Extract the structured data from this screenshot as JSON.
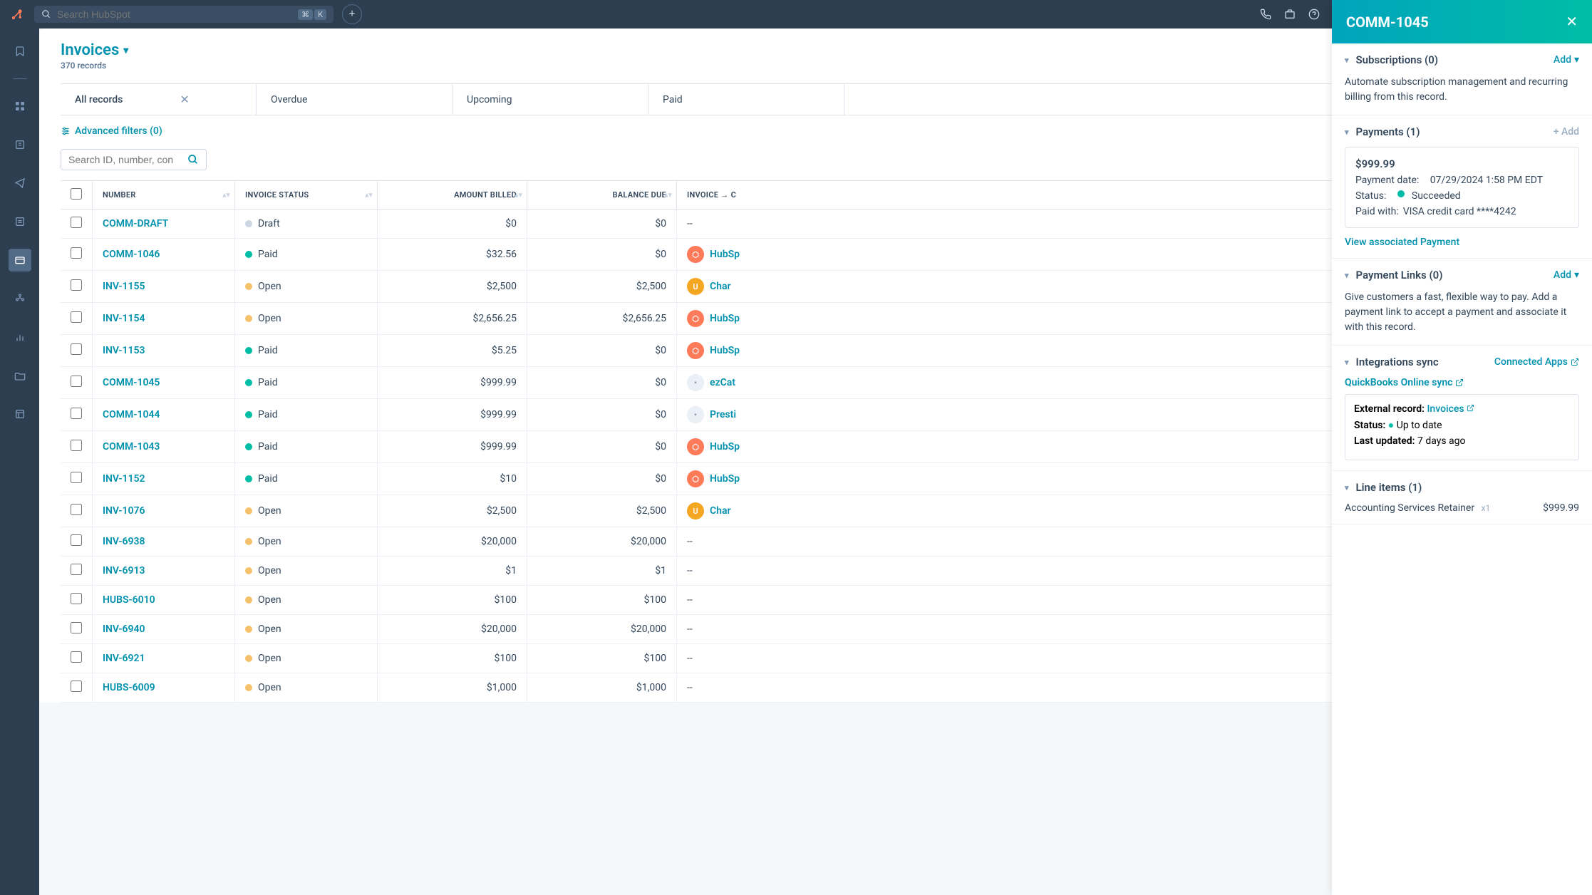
{
  "topbar": {
    "search_placeholder": "Search HubSpot",
    "kbd1": "⌘",
    "kbd2": "K"
  },
  "page": {
    "title": "Invoices",
    "record_count": "370 records"
  },
  "tabs": [
    {
      "label": "All records",
      "closable": true
    },
    {
      "label": "Overdue",
      "closable": false
    },
    {
      "label": "Upcoming",
      "closable": false
    },
    {
      "label": "Paid",
      "closable": false
    }
  ],
  "advanced_filters_label": "Advanced filters (0)",
  "search_table_placeholder": "Search ID, number, con",
  "columns": {
    "number": "Number",
    "status": "Invoice Status",
    "amount": "Amount Billed",
    "balance": "Balance Due",
    "contact": "Invoice → C"
  },
  "rows": [
    {
      "number": "COMM-DRAFT",
      "status": "Draft",
      "status_kind": "draft",
      "amount": "$0",
      "balance": "$0",
      "contact": "--",
      "avatar": ""
    },
    {
      "number": "COMM-1046",
      "status": "Paid",
      "status_kind": "paid",
      "amount": "$32.56",
      "balance": "$0",
      "contact": "HubSp",
      "avatar": "hub"
    },
    {
      "number": "INV-1155",
      "status": "Open",
      "status_kind": "open",
      "amount": "$2,500",
      "balance": "$2,500",
      "contact": "Char ",
      "avatar": "char"
    },
    {
      "number": "INV-1154",
      "status": "Open",
      "status_kind": "open",
      "amount": "$2,656.25",
      "balance": "$2,656.25",
      "contact": "HubSp",
      "avatar": "hub"
    },
    {
      "number": "INV-1153",
      "status": "Paid",
      "status_kind": "paid",
      "amount": "$5.25",
      "balance": "$0",
      "contact": "HubSp",
      "avatar": "hub"
    },
    {
      "number": "COMM-1045",
      "status": "Paid",
      "status_kind": "paid",
      "amount": "$999.99",
      "balance": "$0",
      "contact": "ezCat",
      "avatar": "ez"
    },
    {
      "number": "COMM-1044",
      "status": "Paid",
      "status_kind": "paid",
      "amount": "$999.99",
      "balance": "$0",
      "contact": "Presti",
      "avatar": "pres"
    },
    {
      "number": "COMM-1043",
      "status": "Paid",
      "status_kind": "paid",
      "amount": "$999.99",
      "balance": "$0",
      "contact": "HubSp",
      "avatar": "hub"
    },
    {
      "number": "INV-1152",
      "status": "Paid",
      "status_kind": "paid",
      "amount": "$10",
      "balance": "$0",
      "contact": "HubSp",
      "avatar": "hub"
    },
    {
      "number": "INV-1076",
      "status": "Open",
      "status_kind": "open",
      "amount": "$2,500",
      "balance": "$2,500",
      "contact": "Char ",
      "avatar": "char"
    },
    {
      "number": "INV-6938",
      "status": "Open",
      "status_kind": "open",
      "amount": "$20,000",
      "balance": "$20,000",
      "contact": "--",
      "avatar": ""
    },
    {
      "number": "INV-6913",
      "status": "Open",
      "status_kind": "open",
      "amount": "$1",
      "balance": "$1",
      "contact": "--",
      "avatar": ""
    },
    {
      "number": "HUBS-6010",
      "status": "Open",
      "status_kind": "open",
      "amount": "$100",
      "balance": "$100",
      "contact": "--",
      "avatar": ""
    },
    {
      "number": "INV-6940",
      "status": "Open",
      "status_kind": "open",
      "amount": "$20,000",
      "balance": "$20,000",
      "contact": "--",
      "avatar": ""
    },
    {
      "number": "INV-6921",
      "status": "Open",
      "status_kind": "open",
      "amount": "$100",
      "balance": "$100",
      "contact": "--",
      "avatar": ""
    },
    {
      "number": "HUBS-6009",
      "status": "Open",
      "status_kind": "open",
      "amount": "$1,000",
      "balance": "$1,000",
      "contact": "--",
      "avatar": ""
    }
  ],
  "panel": {
    "title": "COMM-1045",
    "subscriptions": {
      "title": "Subscriptions (0)",
      "action": "Add",
      "desc": "Automate subscription management and recurring billing from this record."
    },
    "payments": {
      "title": "Payments (1)",
      "action": "+ Add",
      "amount": "$999.99",
      "date_label": "Payment date:",
      "date_value": "07/29/2024 1:58 PM EDT",
      "status_label": "Status:",
      "status_value": "Succeeded",
      "paid_with_label": "Paid with:",
      "paid_with_value": "VISA credit card ****4242",
      "view_link": "View associated Payment"
    },
    "payment_links": {
      "title": "Payment Links (0)",
      "action": "Add",
      "desc": "Give customers a fast, flexible way to pay. Add a payment link to accept a payment and associate it with this record."
    },
    "integrations": {
      "title": "Integrations sync",
      "action": "Connected Apps",
      "qb_title": "QuickBooks Online sync",
      "ext_label": "External record:",
      "ext_value": "Invoices",
      "status_label": "Status:",
      "status_value": "Up to date",
      "updated_label": "Last updated:",
      "updated_value": "7 days ago"
    },
    "line_items": {
      "title": "Line items (1)",
      "item_name": "Accounting Services Retainer",
      "item_qty": "x1",
      "item_price": "$999.99"
    }
  }
}
